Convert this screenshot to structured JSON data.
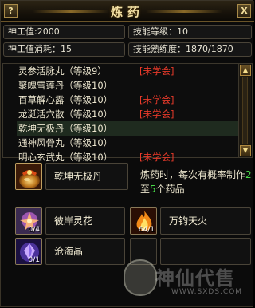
{
  "window": {
    "title": "炼药",
    "help_label": "?",
    "close_label": "X"
  },
  "stats": {
    "shengong_value": "神工值:2000",
    "skill_level": "技能等级：10",
    "shengong_cost": "神工值消耗：15",
    "skill_proficiency": "技能熟练度：1870/1870"
  },
  "recipes": [
    {
      "name": "灵参活脉丸（等级9）",
      "tag": "[未学会]"
    },
    {
      "name": "聚魄雪莲丹（等级10）",
      "tag": ""
    },
    {
      "name": "百草解心露（等级10）",
      "tag": "[未学会]"
    },
    {
      "name": "龙涎活穴散（等级10）",
      "tag": "[未学会]"
    },
    {
      "name": "乾坤无极丹（等级10）",
      "tag": ""
    },
    {
      "name": "通神风骨丸（等级10）",
      "tag": ""
    },
    {
      "name": "明心玄武丸（等级10）",
      "tag": "[未学会]"
    }
  ],
  "selected_recipe": {
    "name": "乾坤无极丹",
    "desc_prefix": "炼药时，每次有概率制作",
    "min": "2",
    "mid": "至",
    "max": "5",
    "desc_suffix": "个药品"
  },
  "materials": [
    {
      "name": "彼岸灵花",
      "count": "0/4",
      "icon": "spirit-flower-icon"
    },
    {
      "name": "万钧天火",
      "count": "64/1",
      "icon": "heaven-fire-icon"
    },
    {
      "name": "沧海晶",
      "count": "0/1",
      "icon": "sea-crystal-icon"
    }
  ],
  "watermark": {
    "text": "神仙代售",
    "url": "WWW.SXDS.COM"
  },
  "colors": {
    "accent_gold": "#f4e2a6",
    "unlearned_red": "#e83a2a",
    "number_green": "#48d848"
  }
}
